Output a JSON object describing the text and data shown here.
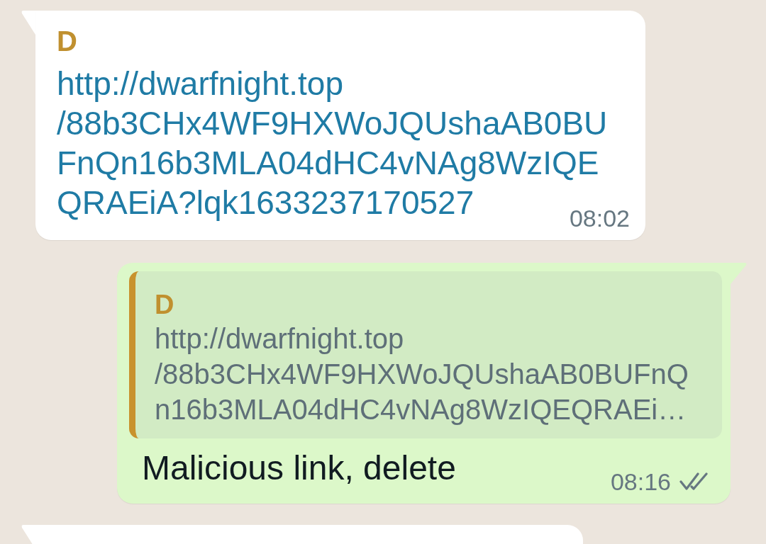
{
  "messages": [
    {
      "kind": "incoming",
      "sender": "D",
      "link_lines": [
        "http://dwarfnight.top",
        "/88b3CHx4WF9HXWoJQUshaAB0BU",
        "FnQn16b3MLA04dHC4vNAg8WzIQE",
        "QRAEiA?lqk1633237170527"
      ],
      "time": "08:02"
    },
    {
      "kind": "outgoing",
      "quote": {
        "sender": "D",
        "text_lines": [
          "http://dwarfnight.top",
          "/88b3CHx4WF9HXWoJQUshaAB0BUFnQ",
          "n16b3MLA04dHC4vNAg8WzIQEQRAEi…"
        ]
      },
      "text": "Malicious link, delete",
      "time": "08:16",
      "delivered": true,
      "read": false
    },
    {
      "kind": "incoming"
    }
  ]
}
